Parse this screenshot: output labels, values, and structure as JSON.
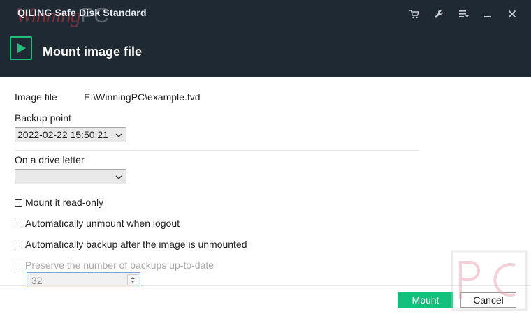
{
  "app": {
    "title": "QILING Safe Disk Standard",
    "watermark_main": "Winning",
    "watermark_pc": "PC"
  },
  "header": {
    "page_title": "Mount image file",
    "icons": [
      "cart-icon",
      "wrench-icon",
      "menu-icon",
      "minimize-icon",
      "close-icon"
    ]
  },
  "form": {
    "image_file_label": "Image file",
    "image_file_value": "E:\\WinningPC\\example.fvd",
    "backup_point_label": "Backup point",
    "backup_point_value": "2022-02-22 15:50:21",
    "drive_letter_label": "On a drive letter",
    "drive_letter_value": "",
    "options": [
      {
        "label": "Mount it read-only",
        "checked": false,
        "disabled": false
      },
      {
        "label": "Automatically unmount when logout",
        "checked": false,
        "disabled": false
      },
      {
        "label": "Automatically backup after the image is unmounted",
        "checked": false,
        "disabled": false
      },
      {
        "label": "Preserve the number of backups up-to-date",
        "checked": false,
        "disabled": true
      }
    ],
    "backups_count": "32"
  },
  "buttons": {
    "mount": "Mount",
    "cancel": "Cancel"
  },
  "colors": {
    "header_bg": "#1f2933",
    "accent": "#11c07a"
  }
}
